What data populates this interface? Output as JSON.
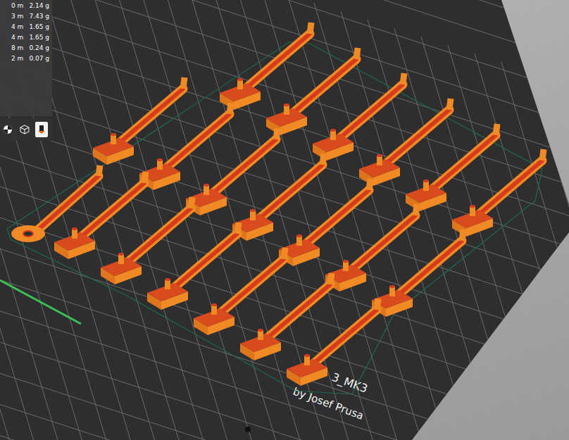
{
  "legend": {
    "rows": [
      {
        "length": "0 m",
        "weight": "2.14 g"
      },
      {
        "length": "3 m",
        "weight": "7.43 g"
      },
      {
        "length": "4 m",
        "weight": "1.65 g"
      },
      {
        "length": "4 m",
        "weight": "1.65 g"
      },
      {
        "length": "8 m",
        "weight": "0.24 g"
      },
      {
        "length": "2 m",
        "weight": "0.07 g"
      }
    ]
  },
  "view_buttons": [
    {
      "selected": false
    },
    {
      "selected": false
    },
    {
      "selected": true
    }
  ],
  "bed": {
    "label": "3_MK3",
    "sublabel": "by Josef Prusa"
  },
  "rows": [
    {
      "objects": [
        {
          "kind": "arm"
        },
        {
          "kind": "arm"
        },
        {
          "kind": "arm"
        },
        {
          "kind": "arm"
        },
        {
          "kind": "arm"
        },
        {
          "kind": "arm"
        }
      ]
    },
    {
      "objects": [
        {
          "kind": "arm"
        },
        {
          "kind": "arm"
        },
        {
          "kind": "arm"
        },
        {
          "kind": "arm"
        },
        {
          "kind": "arm"
        },
        {
          "kind": "arm"
        },
        {
          "kind": "arm"
        }
      ]
    },
    {
      "objects": [
        {
          "kind": "loop"
        },
        {
          "kind": "arm"
        },
        {
          "kind": "arm"
        },
        {
          "kind": "arm"
        },
        {
          "kind": "arm"
        },
        {
          "kind": "arm"
        },
        {
          "kind": "arm"
        }
      ]
    }
  ]
}
